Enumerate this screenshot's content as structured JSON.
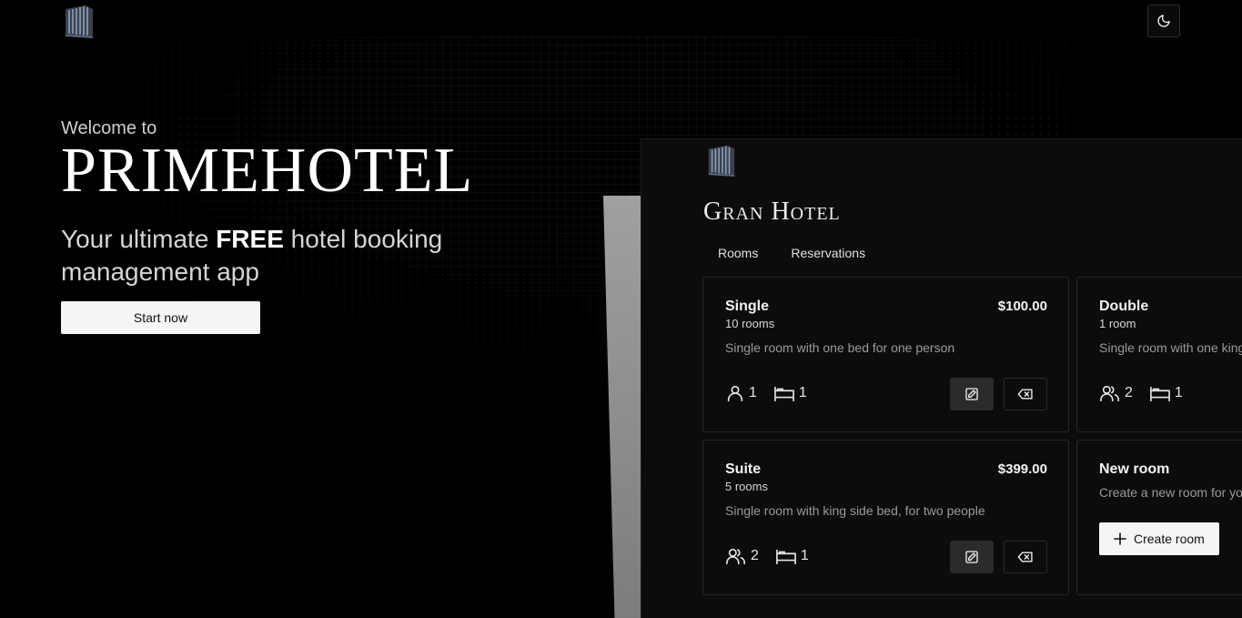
{
  "header": {
    "logo_icon": "hotel-building-icon",
    "theme_toggle_icon": "moon-icon"
  },
  "hero": {
    "welcome": "Welcome to",
    "brand": "PRIMEHOTEL",
    "tagline_pre": "Your ultimate ",
    "tagline_bold": "FREE",
    "tagline_post": " hotel booking management app",
    "cta_label": "Start now"
  },
  "preview": {
    "logo_icon": "hotel-building-icon",
    "title": "Gran Hotel",
    "tabs": [
      {
        "label": "Rooms"
      },
      {
        "label": "Reservations"
      }
    ],
    "rooms": [
      {
        "name": "Single",
        "count": "10 rooms",
        "price": "$100.00",
        "description": "Single room with one bed for one person",
        "guests": "1",
        "beds": "1",
        "guest_icon": "user-icon",
        "bed_icon": "bed-icon"
      },
      {
        "name": "Double",
        "count": "1 room",
        "description": "Single room with one king",
        "guests": "2",
        "beds": "1",
        "guest_icon": "users-icon",
        "bed_icon": "bed-icon"
      },
      {
        "name": "Suite",
        "count": "5 rooms",
        "price": "$399.00",
        "description": "Single room with king side bed, for two people",
        "guests": "2",
        "beds": "1",
        "guest_icon": "users-icon",
        "bed_icon": "bed-icon"
      }
    ],
    "new_room": {
      "title": "New room",
      "description": "Create a new room for yo",
      "button_label": "Create room",
      "button_icon": "plus-icon"
    }
  }
}
